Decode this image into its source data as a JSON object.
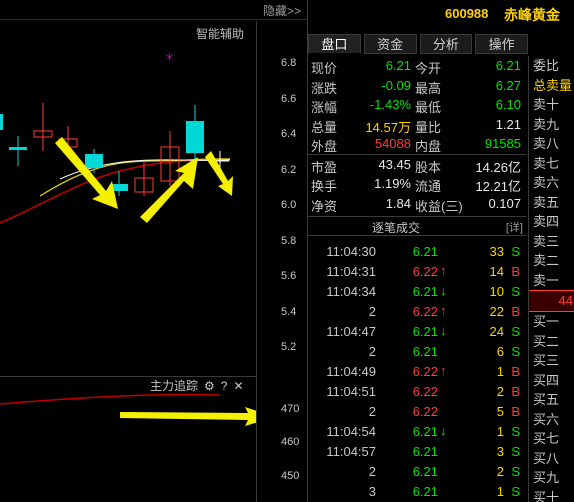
{
  "toolbar": {
    "hide_label": "隐藏>>"
  },
  "chart": {
    "indicator_label": "智能辅助",
    "price_ticks": [
      "6.8",
      "6.6",
      "6.4",
      "6.2",
      "6.0",
      "5.8",
      "5.6",
      "5.4",
      "5.2"
    ],
    "sub_title": "主力追踪",
    "sub_ticks": [
      "470",
      "460",
      "450"
    ],
    "gear_icon": "⚙",
    "help_icon": "?",
    "close_icon": "✕"
  },
  "stock": {
    "code": "600988",
    "name": "赤峰黄金"
  },
  "tabs": [
    {
      "label": "盘口",
      "active": true
    },
    {
      "label": "资金",
      "active": false
    },
    {
      "label": "分析",
      "active": false
    },
    {
      "label": "操作",
      "active": false
    }
  ],
  "quote": [
    {
      "l1": "现价",
      "v1": "6.21",
      "c1": "green",
      "l2": "今开",
      "v2": "6.21",
      "c2": "green"
    },
    {
      "l1": "涨跌",
      "v1": "-0.09",
      "c1": "green",
      "l2": "最高",
      "v2": "6.27",
      "c2": "green"
    },
    {
      "l1": "涨幅",
      "v1": "-1.43%",
      "c1": "green",
      "l2": "最低",
      "v2": "6.10",
      "c2": "green"
    },
    {
      "l1": "总量",
      "v1": "14.57万",
      "c1": "yellow",
      "l2": "量比",
      "v2": "1.21",
      "c2": "white"
    },
    {
      "l1": "外盘",
      "v1": "54088",
      "c1": "red",
      "l2": "内盘",
      "v2": "91585",
      "c2": "green"
    },
    {
      "l1": "市盈",
      "v1": "43.45",
      "c1": "white",
      "l2": "股本",
      "v2": "14.26亿",
      "c2": "white"
    },
    {
      "l1": "换手",
      "v1": "1.19%",
      "c1": "white",
      "l2": "流通",
      "v2": "12.21亿",
      "c2": "white"
    },
    {
      "l1": "净资",
      "v1": "1.84",
      "c1": "white",
      "l2": "收益(三)",
      "v2": "0.107",
      "c2": "white"
    }
  ],
  "trades_header": {
    "title": "逐笔成交",
    "detail": "[详]"
  },
  "trades": [
    {
      "time": "11:04:30",
      "price": "6.21",
      "arrow": "",
      "vol": "33",
      "side": "S"
    },
    {
      "time": "11:04:31",
      "price": "6.22",
      "arrow": "↑",
      "vol": "14",
      "side": "B"
    },
    {
      "time": "11:04:34",
      "price": "6.21",
      "arrow": "↓",
      "vol": "10",
      "side": "S"
    },
    {
      "time": "2",
      "price": "6.22",
      "arrow": "↑",
      "vol": "22",
      "side": "B"
    },
    {
      "time": "11:04:47",
      "price": "6.21",
      "arrow": "↓",
      "vol": "24",
      "side": "S"
    },
    {
      "time": "2",
      "price": "6.21",
      "arrow": "",
      "vol": "6",
      "side": "S"
    },
    {
      "time": "11:04:49",
      "price": "6.22",
      "arrow": "↑",
      "vol": "1",
      "side": "B"
    },
    {
      "time": "11:04:51",
      "price": "6.22",
      "arrow": "",
      "vol": "2",
      "side": "B"
    },
    {
      "time": "2",
      "price": "6.22",
      "arrow": "",
      "vol": "5",
      "side": "B"
    },
    {
      "time": "11:04:54",
      "price": "6.21",
      "arrow": "↓",
      "vol": "1",
      "side": "S"
    },
    {
      "time": "11:04:57",
      "price": "6.21",
      "arrow": "",
      "vol": "3",
      "side": "S"
    },
    {
      "time": "2",
      "price": "6.21",
      "arrow": "",
      "vol": "2",
      "side": "S"
    },
    {
      "time": "3",
      "price": "6.21",
      "arrow": "",
      "vol": "1",
      "side": "S"
    }
  ],
  "order_book": {
    "top": [
      "委比",
      "总卖量",
      "卖十",
      "卖九",
      "卖八",
      "卖七",
      "卖六",
      "卖五",
      "卖四",
      "卖三",
      "卖二",
      "卖一"
    ],
    "mid": "44",
    "bottom": [
      "买一",
      "买二",
      "买三",
      "买四",
      "买五",
      "买六",
      "买七",
      "买八",
      "买九",
      "买十"
    ]
  }
}
